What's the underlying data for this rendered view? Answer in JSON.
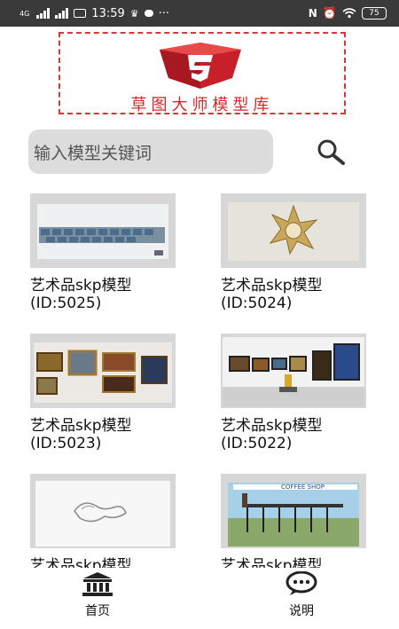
{
  "status_bar": {
    "time": "13:59",
    "signal_label": "4G",
    "battery": "75"
  },
  "header": {
    "title": "草图大师模型库",
    "brand_color": "#d22b2b"
  },
  "search": {
    "placeholder": "输入模型关键词"
  },
  "items": [
    {
      "title": "艺术品skp模型",
      "id": "(ID:5025)"
    },
    {
      "title": "艺术品skp模型",
      "id": "(ID:5024)"
    },
    {
      "title": "艺术品skp模型",
      "id": "(ID:5023)"
    },
    {
      "title": "艺术品skp模型",
      "id": "(ID:5022)"
    },
    {
      "title": "艺术品skp模型",
      "id": ""
    },
    {
      "title": "艺术品skp模型",
      "id": ""
    }
  ],
  "thumb_text": {
    "coffee_shop": "COFFEE SHOP"
  },
  "bottom_nav": {
    "home_label": "首页",
    "about_label": "说明"
  }
}
